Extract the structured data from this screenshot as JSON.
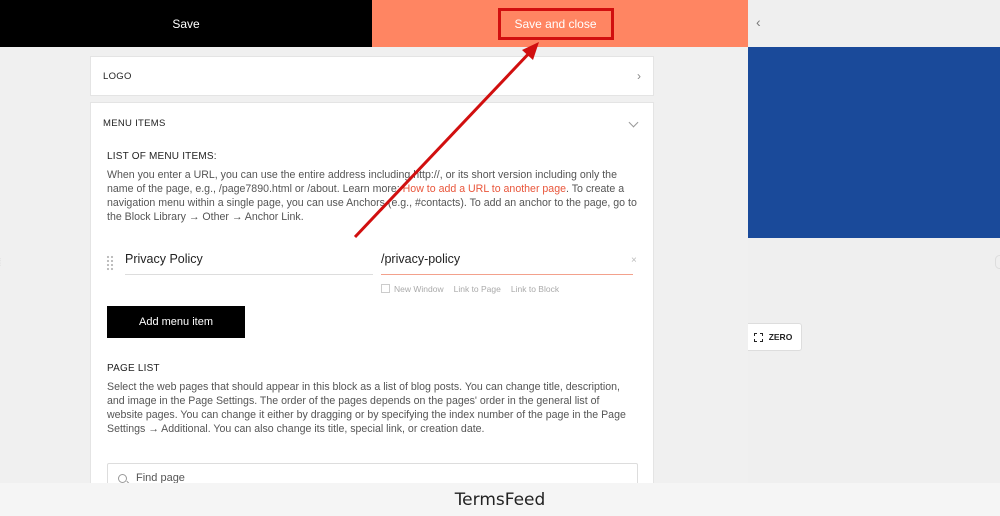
{
  "toolbar": {
    "save_label": "Save",
    "save_close_label": "Save and close"
  },
  "logo_section": {
    "title": "LOGO"
  },
  "menu_section": {
    "title": "MENU ITEMS",
    "list_label": "LIST OF MENU ITEMS:",
    "help_before_link": "When you enter a URL, you can use the entire address including http://, or its short version including only the name of the page, e.g., /page7890.html or /about. Learn more: ",
    "help_link": "How to add a URL to another page",
    "help_after_link": ". To create a navigation menu within a single page, you can use Anchors (e.g., #contacts). To add an anchor to the page, go to the Block Library → Other → Anchor Link.",
    "item": {
      "title": "Privacy Policy",
      "url": "/privacy-policy",
      "clear": "×"
    },
    "link_options": {
      "new_window": "New Window",
      "link_to_page": "Link to Page",
      "link_to_block": "Link to Block"
    },
    "add_button": "Add menu item"
  },
  "page_list": {
    "title": "PAGE LIST",
    "help": "Select the web pages that should appear in this block as a list of blog posts. You can change title, description, and image in the Page Settings. The order of the pages depends on the pages' order in the general list of website pages. You can change it either by dragging or by specifying the index number of the page in the Page Settings → Additional. You can also change its title, special link, or creation date.",
    "search_placeholder": "Find page"
  },
  "preview": {
    "zero_label": "ZERO",
    "accent_color": "#1a4a9a"
  },
  "icons": {
    "collapse": "chevron-left-icon",
    "logo_expand": "chevron-right-icon",
    "menu_collapse": "chevron-down-icon"
  },
  "colors": {
    "save_close_bg": "#ff8562",
    "highlight": "#d10f0f",
    "link": "#e9563b"
  },
  "footer": {
    "brand": "TermsFeed"
  }
}
